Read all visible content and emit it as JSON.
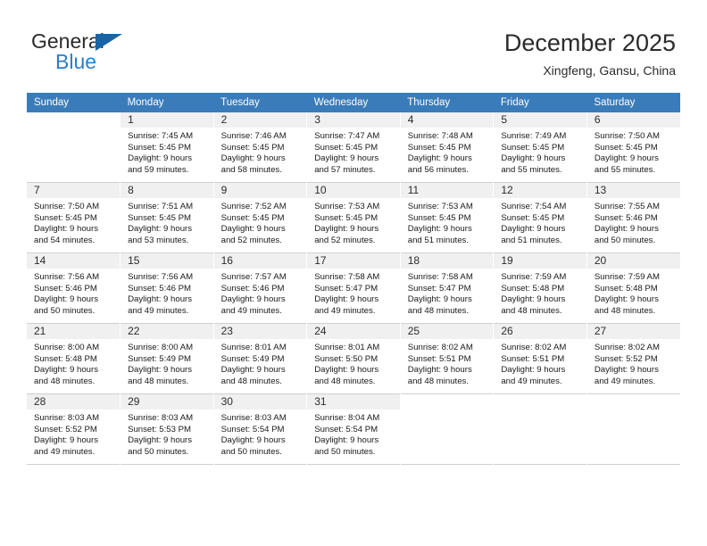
{
  "brand": {
    "name_part1": "General",
    "name_part2": "Blue",
    "accent_color": "#2a7fc9",
    "triangle_color": "#1565a8"
  },
  "header": {
    "title": "December 2025",
    "subtitle": "Xingfeng, Gansu, China"
  },
  "calendar": {
    "header_bg": "#3a7cba",
    "weekdays": [
      "Sunday",
      "Monday",
      "Tuesday",
      "Wednesday",
      "Thursday",
      "Friday",
      "Saturday"
    ],
    "weeks": [
      [
        {
          "day": "",
          "sunrise": "",
          "sunset": "",
          "daylight1": "",
          "daylight2": ""
        },
        {
          "day": "1",
          "sunrise": "Sunrise: 7:45 AM",
          "sunset": "Sunset: 5:45 PM",
          "daylight1": "Daylight: 9 hours",
          "daylight2": "and 59 minutes."
        },
        {
          "day": "2",
          "sunrise": "Sunrise: 7:46 AM",
          "sunset": "Sunset: 5:45 PM",
          "daylight1": "Daylight: 9 hours",
          "daylight2": "and 58 minutes."
        },
        {
          "day": "3",
          "sunrise": "Sunrise: 7:47 AM",
          "sunset": "Sunset: 5:45 PM",
          "daylight1": "Daylight: 9 hours",
          "daylight2": "and 57 minutes."
        },
        {
          "day": "4",
          "sunrise": "Sunrise: 7:48 AM",
          "sunset": "Sunset: 5:45 PM",
          "daylight1": "Daylight: 9 hours",
          "daylight2": "and 56 minutes."
        },
        {
          "day": "5",
          "sunrise": "Sunrise: 7:49 AM",
          "sunset": "Sunset: 5:45 PM",
          "daylight1": "Daylight: 9 hours",
          "daylight2": "and 55 minutes."
        },
        {
          "day": "6",
          "sunrise": "Sunrise: 7:50 AM",
          "sunset": "Sunset: 5:45 PM",
          "daylight1": "Daylight: 9 hours",
          "daylight2": "and 55 minutes."
        }
      ],
      [
        {
          "day": "7",
          "sunrise": "Sunrise: 7:50 AM",
          "sunset": "Sunset: 5:45 PM",
          "daylight1": "Daylight: 9 hours",
          "daylight2": "and 54 minutes."
        },
        {
          "day": "8",
          "sunrise": "Sunrise: 7:51 AM",
          "sunset": "Sunset: 5:45 PM",
          "daylight1": "Daylight: 9 hours",
          "daylight2": "and 53 minutes."
        },
        {
          "day": "9",
          "sunrise": "Sunrise: 7:52 AM",
          "sunset": "Sunset: 5:45 PM",
          "daylight1": "Daylight: 9 hours",
          "daylight2": "and 52 minutes."
        },
        {
          "day": "10",
          "sunrise": "Sunrise: 7:53 AM",
          "sunset": "Sunset: 5:45 PM",
          "daylight1": "Daylight: 9 hours",
          "daylight2": "and 52 minutes."
        },
        {
          "day": "11",
          "sunrise": "Sunrise: 7:53 AM",
          "sunset": "Sunset: 5:45 PM",
          "daylight1": "Daylight: 9 hours",
          "daylight2": "and 51 minutes."
        },
        {
          "day": "12",
          "sunrise": "Sunrise: 7:54 AM",
          "sunset": "Sunset: 5:45 PM",
          "daylight1": "Daylight: 9 hours",
          "daylight2": "and 51 minutes."
        },
        {
          "day": "13",
          "sunrise": "Sunrise: 7:55 AM",
          "sunset": "Sunset: 5:46 PM",
          "daylight1": "Daylight: 9 hours",
          "daylight2": "and 50 minutes."
        }
      ],
      [
        {
          "day": "14",
          "sunrise": "Sunrise: 7:56 AM",
          "sunset": "Sunset: 5:46 PM",
          "daylight1": "Daylight: 9 hours",
          "daylight2": "and 50 minutes."
        },
        {
          "day": "15",
          "sunrise": "Sunrise: 7:56 AM",
          "sunset": "Sunset: 5:46 PM",
          "daylight1": "Daylight: 9 hours",
          "daylight2": "and 49 minutes."
        },
        {
          "day": "16",
          "sunrise": "Sunrise: 7:57 AM",
          "sunset": "Sunset: 5:46 PM",
          "daylight1": "Daylight: 9 hours",
          "daylight2": "and 49 minutes."
        },
        {
          "day": "17",
          "sunrise": "Sunrise: 7:58 AM",
          "sunset": "Sunset: 5:47 PM",
          "daylight1": "Daylight: 9 hours",
          "daylight2": "and 49 minutes."
        },
        {
          "day": "18",
          "sunrise": "Sunrise: 7:58 AM",
          "sunset": "Sunset: 5:47 PM",
          "daylight1": "Daylight: 9 hours",
          "daylight2": "and 48 minutes."
        },
        {
          "day": "19",
          "sunrise": "Sunrise: 7:59 AM",
          "sunset": "Sunset: 5:48 PM",
          "daylight1": "Daylight: 9 hours",
          "daylight2": "and 48 minutes."
        },
        {
          "day": "20",
          "sunrise": "Sunrise: 7:59 AM",
          "sunset": "Sunset: 5:48 PM",
          "daylight1": "Daylight: 9 hours",
          "daylight2": "and 48 minutes."
        }
      ],
      [
        {
          "day": "21",
          "sunrise": "Sunrise: 8:00 AM",
          "sunset": "Sunset: 5:48 PM",
          "daylight1": "Daylight: 9 hours",
          "daylight2": "and 48 minutes."
        },
        {
          "day": "22",
          "sunrise": "Sunrise: 8:00 AM",
          "sunset": "Sunset: 5:49 PM",
          "daylight1": "Daylight: 9 hours",
          "daylight2": "and 48 minutes."
        },
        {
          "day": "23",
          "sunrise": "Sunrise: 8:01 AM",
          "sunset": "Sunset: 5:49 PM",
          "daylight1": "Daylight: 9 hours",
          "daylight2": "and 48 minutes."
        },
        {
          "day": "24",
          "sunrise": "Sunrise: 8:01 AM",
          "sunset": "Sunset: 5:50 PM",
          "daylight1": "Daylight: 9 hours",
          "daylight2": "and 48 minutes."
        },
        {
          "day": "25",
          "sunrise": "Sunrise: 8:02 AM",
          "sunset": "Sunset: 5:51 PM",
          "daylight1": "Daylight: 9 hours",
          "daylight2": "and 48 minutes."
        },
        {
          "day": "26",
          "sunrise": "Sunrise: 8:02 AM",
          "sunset": "Sunset: 5:51 PM",
          "daylight1": "Daylight: 9 hours",
          "daylight2": "and 49 minutes."
        },
        {
          "day": "27",
          "sunrise": "Sunrise: 8:02 AM",
          "sunset": "Sunset: 5:52 PM",
          "daylight1": "Daylight: 9 hours",
          "daylight2": "and 49 minutes."
        }
      ],
      [
        {
          "day": "28",
          "sunrise": "Sunrise: 8:03 AM",
          "sunset": "Sunset: 5:52 PM",
          "daylight1": "Daylight: 9 hours",
          "daylight2": "and 49 minutes."
        },
        {
          "day": "29",
          "sunrise": "Sunrise: 8:03 AM",
          "sunset": "Sunset: 5:53 PM",
          "daylight1": "Daylight: 9 hours",
          "daylight2": "and 50 minutes."
        },
        {
          "day": "30",
          "sunrise": "Sunrise: 8:03 AM",
          "sunset": "Sunset: 5:54 PM",
          "daylight1": "Daylight: 9 hours",
          "daylight2": "and 50 minutes."
        },
        {
          "day": "31",
          "sunrise": "Sunrise: 8:04 AM",
          "sunset": "Sunset: 5:54 PM",
          "daylight1": "Daylight: 9 hours",
          "daylight2": "and 50 minutes."
        },
        {
          "day": "",
          "sunrise": "",
          "sunset": "",
          "daylight1": "",
          "daylight2": ""
        },
        {
          "day": "",
          "sunrise": "",
          "sunset": "",
          "daylight1": "",
          "daylight2": ""
        },
        {
          "day": "",
          "sunrise": "",
          "sunset": "",
          "daylight1": "",
          "daylight2": ""
        }
      ]
    ]
  }
}
